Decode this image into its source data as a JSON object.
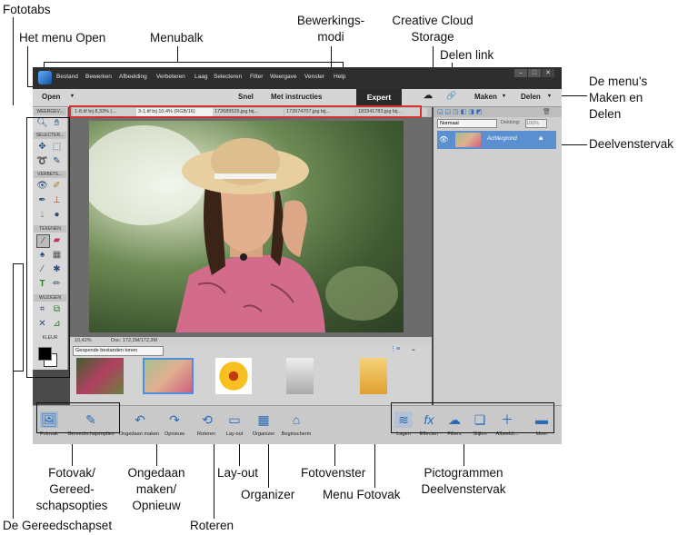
{
  "callouts": {
    "fototabs": "Fototabs",
    "menu_open": "Het menu Open",
    "menubalk": "Menubalk",
    "bewerkingsmodi_1": "Bewerkings-",
    "bewerkingsmodi_2": "modi",
    "creative_cloud_1": "Creative Cloud",
    "creative_cloud_2": "Storage",
    "delen_link": "Delen link",
    "menus_1": "De menu’s",
    "menus_2": "Maken en",
    "menus_3": "Delen",
    "deelvenstervak": "Deelvenstervak",
    "fotovak_1": "Fotovak/",
    "fotovak_2": "Gereed-",
    "fotovak_3": "schapsopties",
    "ongedaan_1": "Ongedaan",
    "ongedaan_2": "maken/",
    "ongedaan_3": "Opnieuw",
    "layout": "Lay-out",
    "organizer": "Organizer",
    "fotovenster": "Fotovenster",
    "menu_fotovak": "Menu Fotovak",
    "pictogrammen_1": "Pictogrammen",
    "pictogrammen_2": "Deelvenstervak",
    "gereedschapset": "De Gereedschapset",
    "roteren": "Roteren"
  },
  "menubar": {
    "items": [
      "Bestand",
      "Bewerken",
      "Afbeelding",
      "Verbeteren",
      "Laag",
      "Selecteren",
      "Filter",
      "Weergave",
      "Venster",
      "Help"
    ]
  },
  "modebar": {
    "open": "Open",
    "snel": "Snel",
    "met_instructies": "Met instructies",
    "expert": "Expert",
    "maken": "Maken",
    "delen": "Delen"
  },
  "toolbox": {
    "sections": [
      "WEERGEV...",
      "SELECTER...",
      "VERBETE...",
      "TEKENEN",
      "WIJZIGEN",
      "KLEUR"
    ]
  },
  "tabs": [
    "1-8.tif bij 8,33% (...",
    "3-1.tif bij 10,4% (RGB/16)",
    "172689526.jpg bij...",
    "173974707.jpg bij...",
    "183341783.jpg bij..."
  ],
  "status": {
    "zoom": "10,42%",
    "doc": "Doc: 172,3M/172,3M"
  },
  "photobin": {
    "dropdown": "Geopende bestanden tonen"
  },
  "panel": {
    "blend": "Normaal",
    "opacity_label": "Dekking:",
    "opacity_value": "100%",
    "layer_name": "Achtergrond"
  },
  "taskbar": {
    "fotovak": "Fotovak",
    "gereedschapsopties": "Gereedschapsopties",
    "ongedaan": "Ongedaan maken",
    "opnieuw": "Opnieuw",
    "roteren": "Roteren",
    "layout": "Lay-out",
    "organizer": "Organizer",
    "beginscherm": "Beginscherm",
    "lagen": "Lagen",
    "effecten": "Effecten",
    "filters": "Filters",
    "stijlen": "Stijlen",
    "afbeeldingen": "Afbeeldi...",
    "meer": "Meer"
  }
}
